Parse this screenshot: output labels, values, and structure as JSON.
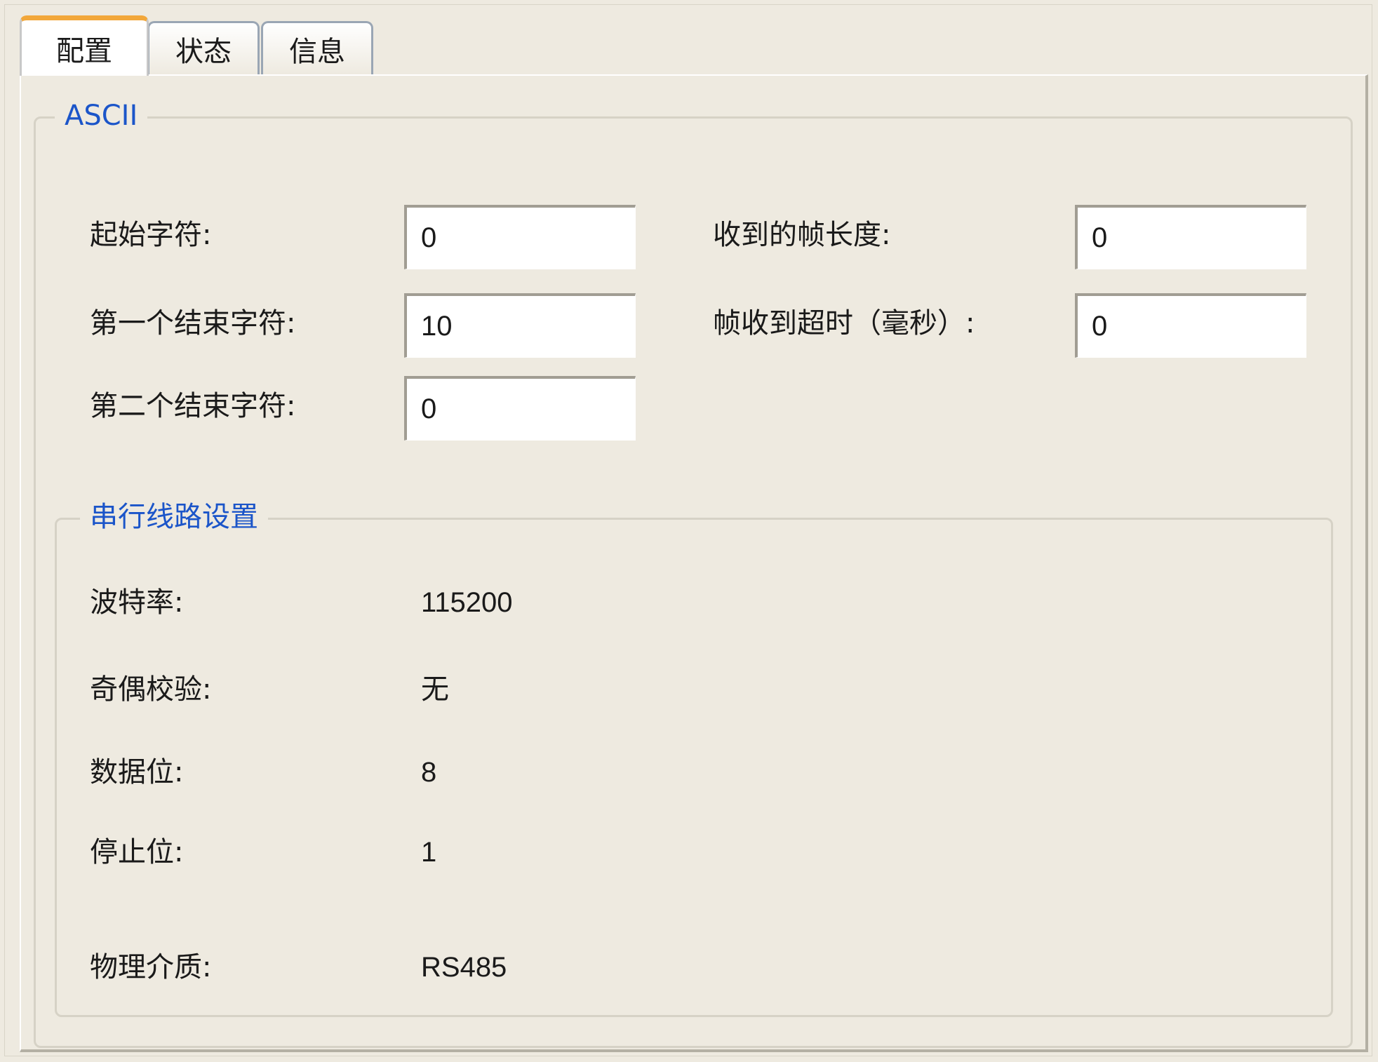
{
  "tabs": [
    {
      "label": "配置",
      "active": true
    },
    {
      "label": "状态",
      "active": false
    },
    {
      "label": "信息",
      "active": false
    }
  ],
  "ascii": {
    "title": "ASCII",
    "start_char": {
      "label": "起始字符:",
      "value": "0"
    },
    "first_end_char": {
      "label": "第一个结束字符:",
      "value": "10"
    },
    "second_end_char": {
      "label": "第二个结束字符:",
      "value": "0"
    },
    "frame_length": {
      "label": "收到的帧长度:",
      "value": "0"
    },
    "frame_timeout": {
      "label": "帧收到超时（毫秒）:",
      "value": "0"
    }
  },
  "serial": {
    "title": "串行线路设置",
    "baud_rate": {
      "label": "波特率:",
      "value": "115200"
    },
    "parity": {
      "label": "奇偶校验:",
      "value": "无"
    },
    "data_bits": {
      "label": "数据位:",
      "value": "8"
    },
    "stop_bits": {
      "label": "停止位:",
      "value": "1"
    },
    "physical_medium": {
      "label": "物理介质:",
      "value": "RS485"
    }
  },
  "colors": {
    "background": "#eeeae0",
    "legend_blue": "#1b55c9",
    "active_tab_accent": "#f2a73a"
  }
}
